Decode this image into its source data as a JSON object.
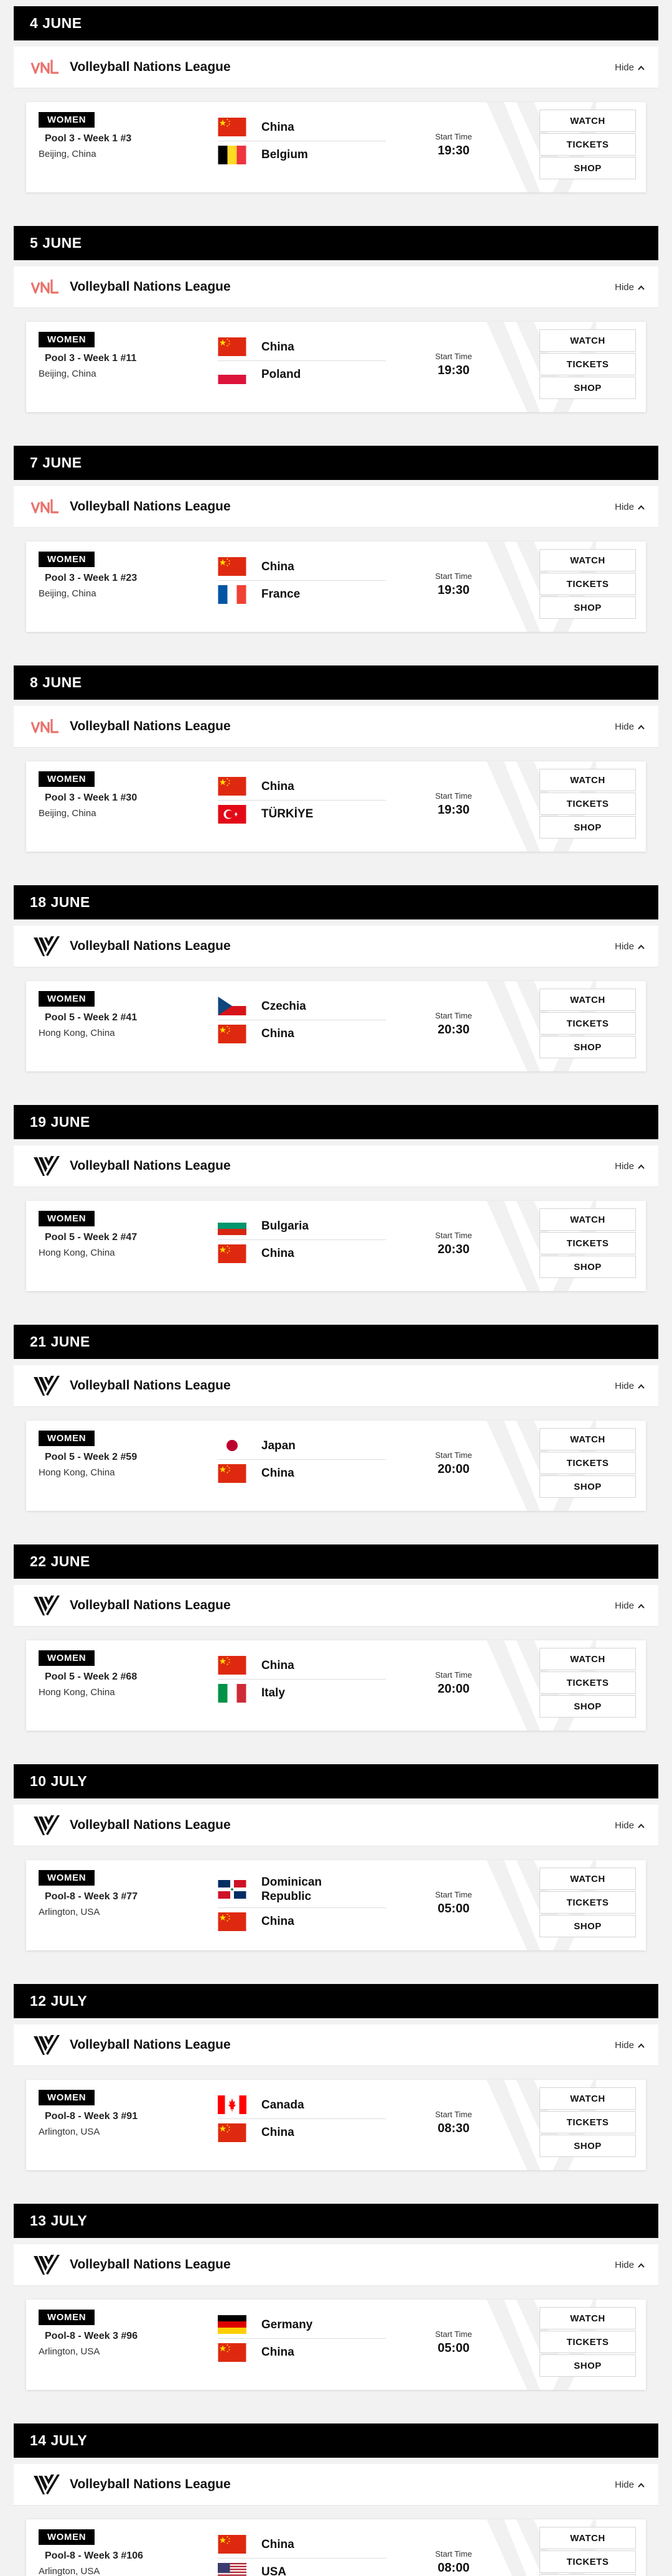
{
  "league_name": "Volleyball Nations League",
  "hide_label": "Hide",
  "start_time_label": "Start Time",
  "actions": {
    "watch": "WATCH",
    "tickets": "TICKETS",
    "shop": "SHOP"
  },
  "days": [
    {
      "date": "4 JUNE",
      "logo": "vnl-logo",
      "match": {
        "category": "WOMEN",
        "pool": "Pool 3 - Week 1 #3",
        "venue": "Beijing, China",
        "home": {
          "name": "China",
          "flag": "flag-china"
        },
        "away": {
          "name": "Belgium",
          "flag": "flag-belgium"
        },
        "time": "19:30"
      }
    },
    {
      "date": "5 JUNE",
      "logo": "vnl-logo",
      "match": {
        "category": "WOMEN",
        "pool": "Pool 3 - Week 1 #11",
        "venue": "Beijing, China",
        "home": {
          "name": "China",
          "flag": "flag-china"
        },
        "away": {
          "name": "Poland",
          "flag": "flag-poland"
        },
        "time": "19:30"
      }
    },
    {
      "date": "7 JUNE",
      "logo": "vnl-logo",
      "match": {
        "category": "WOMEN",
        "pool": "Pool 3 - Week 1 #23",
        "venue": "Beijing, China",
        "home": {
          "name": "China",
          "flag": "flag-china"
        },
        "away": {
          "name": "France",
          "flag": "flag-france"
        },
        "time": "19:30"
      }
    },
    {
      "date": "8 JUNE",
      "logo": "vnl-logo",
      "match": {
        "category": "WOMEN",
        "pool": "Pool 3 - Week 1 #30",
        "venue": "Beijing, China",
        "home": {
          "name": "China",
          "flag": "flag-china"
        },
        "away": {
          "name": "TÜRKİYE",
          "flag": "flag-turkey"
        },
        "time": "19:30"
      }
    },
    {
      "date": "18 JUNE",
      "logo": "v-logo",
      "match": {
        "category": "WOMEN",
        "pool": "Pool 5 - Week 2 #41",
        "venue": "Hong Kong, China",
        "home": {
          "name": "Czechia",
          "flag": "flag-czechia"
        },
        "away": {
          "name": "China",
          "flag": "flag-china"
        },
        "time": "20:30"
      }
    },
    {
      "date": "19 JUNE",
      "logo": "v-logo",
      "match": {
        "category": "WOMEN",
        "pool": "Pool 5 - Week 2 #47",
        "venue": "Hong Kong, China",
        "home": {
          "name": "Bulgaria",
          "flag": "flag-bulgaria"
        },
        "away": {
          "name": "China",
          "flag": "flag-china"
        },
        "time": "20:30"
      }
    },
    {
      "date": "21 JUNE",
      "logo": "v-logo",
      "match": {
        "category": "WOMEN",
        "pool": "Pool 5 - Week 2 #59",
        "venue": "Hong Kong, China",
        "home": {
          "name": "Japan",
          "flag": "flag-japan"
        },
        "away": {
          "name": "China",
          "flag": "flag-china"
        },
        "time": "20:00"
      }
    },
    {
      "date": "22 JUNE",
      "logo": "v-logo",
      "match": {
        "category": "WOMEN",
        "pool": "Pool 5 - Week 2 #68",
        "venue": "Hong Kong, China",
        "home": {
          "name": "China",
          "flag": "flag-china"
        },
        "away": {
          "name": "Italy",
          "flag": "flag-italy"
        },
        "time": "20:00"
      }
    },
    {
      "date": "10 JULY",
      "logo": "v-logo",
      "match": {
        "category": "WOMEN",
        "pool": "Pool-8 - Week 3 #77",
        "venue": "Arlington, USA",
        "home": {
          "name": "Dominican Republic",
          "flag": "flag-dominican-republic"
        },
        "away": {
          "name": "China",
          "flag": "flag-china"
        },
        "time": "05:00"
      }
    },
    {
      "date": "12 JULY",
      "logo": "v-logo",
      "match": {
        "category": "WOMEN",
        "pool": "Pool-8 - Week 3 #91",
        "venue": "Arlington, USA",
        "home": {
          "name": "Canada",
          "flag": "flag-canada"
        },
        "away": {
          "name": "China",
          "flag": "flag-china"
        },
        "time": "08:30"
      }
    },
    {
      "date": "13 JULY",
      "logo": "v-logo",
      "match": {
        "category": "WOMEN",
        "pool": "Pool-8 - Week 3 #96",
        "venue": "Arlington, USA",
        "home": {
          "name": "Germany",
          "flag": "flag-germany"
        },
        "away": {
          "name": "China",
          "flag": "flag-china"
        },
        "time": "05:00"
      }
    },
    {
      "date": "14 JULY",
      "logo": "v-logo",
      "match": {
        "category": "WOMEN",
        "pool": "Pool-8 - Week 3 #106",
        "venue": "Arlington, USA",
        "home": {
          "name": "China",
          "flag": "flag-china"
        },
        "away": {
          "name": "USA",
          "flag": "flag-usa"
        },
        "time": "08:00"
      }
    }
  ]
}
